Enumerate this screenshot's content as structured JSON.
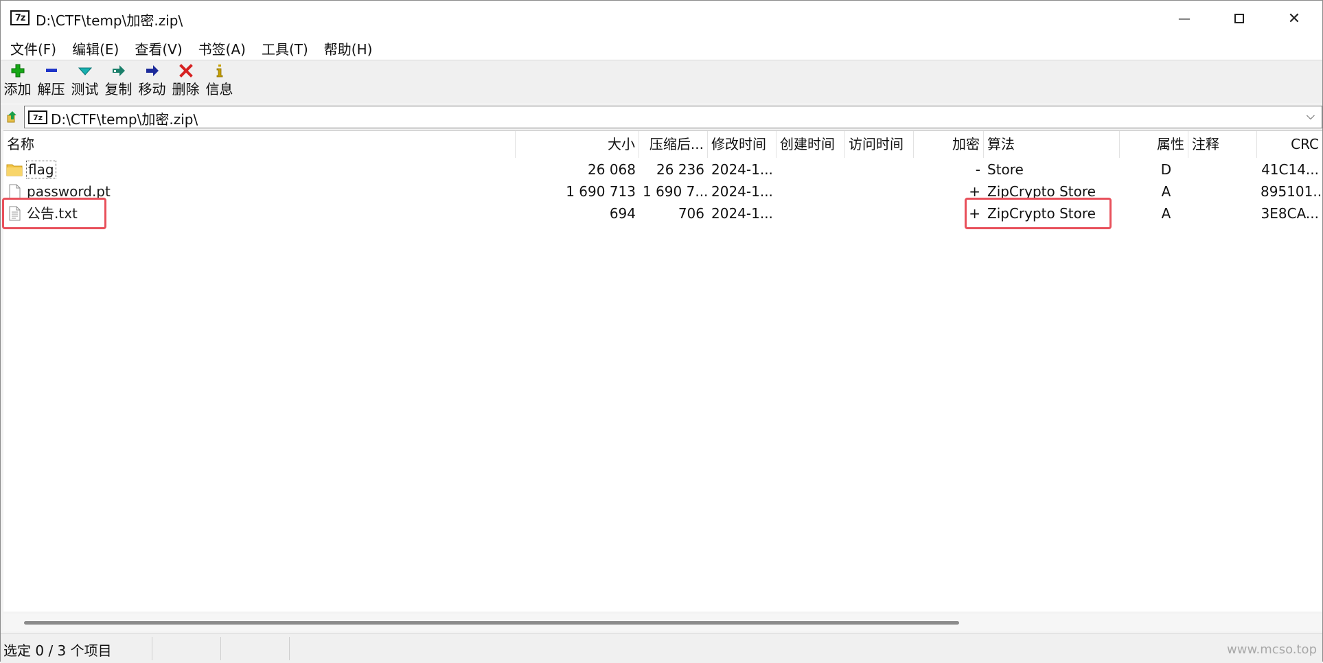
{
  "window": {
    "title": "D:\\CTF\\temp\\加密.zip\\",
    "app_icon_text": "7z",
    "controls": {
      "minimize": "—",
      "close": "✕"
    }
  },
  "menu": [
    "文件(F)",
    "编辑(E)",
    "查看(V)",
    "书签(A)",
    "工具(T)",
    "帮助(H)"
  ],
  "toolbar": [
    {
      "label": "添加",
      "icon": "plus-icon",
      "color": "#16a816"
    },
    {
      "label": "解压",
      "icon": "minus-icon",
      "color": "#1f35c8"
    },
    {
      "label": "测试",
      "icon": "check-icon",
      "color": "#18b0b0"
    },
    {
      "label": "复制",
      "icon": "copy-arrow-icon",
      "color": "#1a7f6a"
    },
    {
      "label": "移动",
      "icon": "move-arrow-icon",
      "color": "#1c2a9a"
    },
    {
      "label": "删除",
      "icon": "delete-x-icon",
      "color": "#d62020"
    },
    {
      "label": "信息",
      "icon": "info-icon",
      "color": "#c6a000"
    }
  ],
  "address": {
    "path": "D:\\CTF\\temp\\加密.zip\\"
  },
  "columns": {
    "name": "名称",
    "size": "大小",
    "packed": "压缩后...",
    "modified": "修改时间",
    "created": "创建时间",
    "accessed": "访问时间",
    "encrypted": "加密",
    "method": "算法",
    "attributes": "属性",
    "comment": "注释",
    "crc": "CRC"
  },
  "rows": [
    {
      "icon": "folder-icon",
      "name": "flag",
      "size": "26 068",
      "packed": "26 236",
      "modified": "2024-1...",
      "encrypted": "-",
      "method": "Store",
      "attributes": "D",
      "crc": "41C14..."
    },
    {
      "icon": "file-icon",
      "name": "password.pt",
      "size": "1 690 713",
      "packed": "1 690 7...",
      "modified": "2024-1...",
      "encrypted": "+",
      "method": "ZipCrypto Store",
      "attributes": "A",
      "crc": "895101..."
    },
    {
      "icon": "text-file-icon",
      "name": "公告.txt",
      "size": "694",
      "packed": "706",
      "modified": "2024-1...",
      "encrypted": "+",
      "method": "ZipCrypto Store",
      "attributes": "A",
      "crc": "3E8CA..."
    }
  ],
  "status": {
    "selection": "选定 0 / 3 个项目",
    "watermark": "www.mcso.top"
  },
  "highlight_color": "#e8505b"
}
